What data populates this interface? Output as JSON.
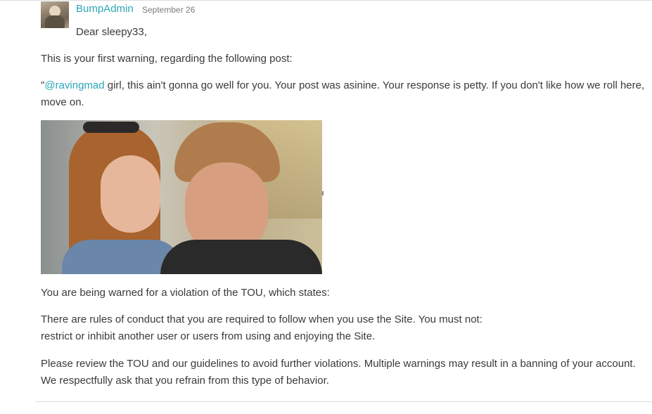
{
  "post": {
    "author": "BumpAdmin",
    "date": "September 26",
    "greeting": "Dear sleepy33,",
    "intro": "This is your first warning, regarding the following post:",
    "quote": {
      "open_quote": "\"",
      "mention": "@ravingmad",
      "text": " girl, this ain't gonna go well for you. Your post was asinine. Your response is petty. If you don't like how we roll here, move on."
    },
    "violation_heading": "You are being warned for a violation of the TOU, which states:",
    "rule_line1": "There are rules of conduct that you are required to follow when you use the Site. You must not:",
    "rule_line2": "restrict or inhibit another user or users from using and enjoying the Site.",
    "closing": "Please review the TOU and our guidelines to avoid further violations. Multiple warnings may result in a banning of your account. We respectfully ask that you refrain from this type of behavior."
  },
  "colors": {
    "accent": "#2aa7b8",
    "text": "#3a3a3a",
    "muted": "#7b7b7b"
  }
}
